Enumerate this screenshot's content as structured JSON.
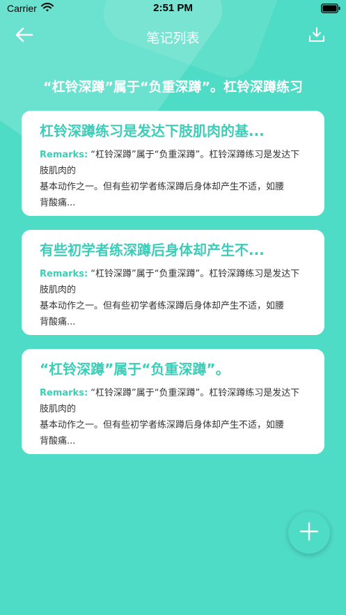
{
  "status_bar": {
    "carrier": "Carrier",
    "time": "2:51 PM"
  },
  "nav": {
    "title": "笔记列表",
    "back_icon": "arrow-left-icon",
    "download_icon": "download-icon"
  },
  "subtitle": "“杠铃深蹲”属于“负重深蹲”。杠铃深蹲练习",
  "notes": [
    {
      "title": "杠铃深蹲练习是发达下肢肌肉的基...",
      "remarks_label": "Remarks:",
      "line1": " “杠铃深蹲”属于“负重深蹲”。杠铃深蹲练习是发达下",
      "line2": "肢肌肉的",
      "line3": "基本动作之一。但有些初学者练深蹲后身体却产生不适，如腰",
      "line4": "背酸痛..."
    },
    {
      "title": "有些初学者练深蹲后身体却产生不...",
      "remarks_label": "Remarks:",
      "line1": " “杠铃深蹲”属于“负重深蹲”。杠铃深蹲练习是发达下",
      "line2": "肢肌肉的",
      "line3": "基本动作之一。但有些初学者练深蹲后身体却产生不适，如腰",
      "line4": "背酸痛..."
    },
    {
      "title": "“杠铃深蹲”属于“负重深蹲”。",
      "remarks_label": "Remarks:",
      "line1": " “杠铃深蹲”属于“负重深蹲”。杠铃深蹲练习是发达下",
      "line2": "肢肌肉的",
      "line3": "基本动作之一。但有些初学者练深蹲后身体却产生不适，如腰",
      "line4": "背酸痛..."
    }
  ],
  "fab": {
    "icon": "plus-icon"
  },
  "colors": {
    "background": "#4fdcc6",
    "accent": "#3ccdb8",
    "card": "#ffffff"
  }
}
